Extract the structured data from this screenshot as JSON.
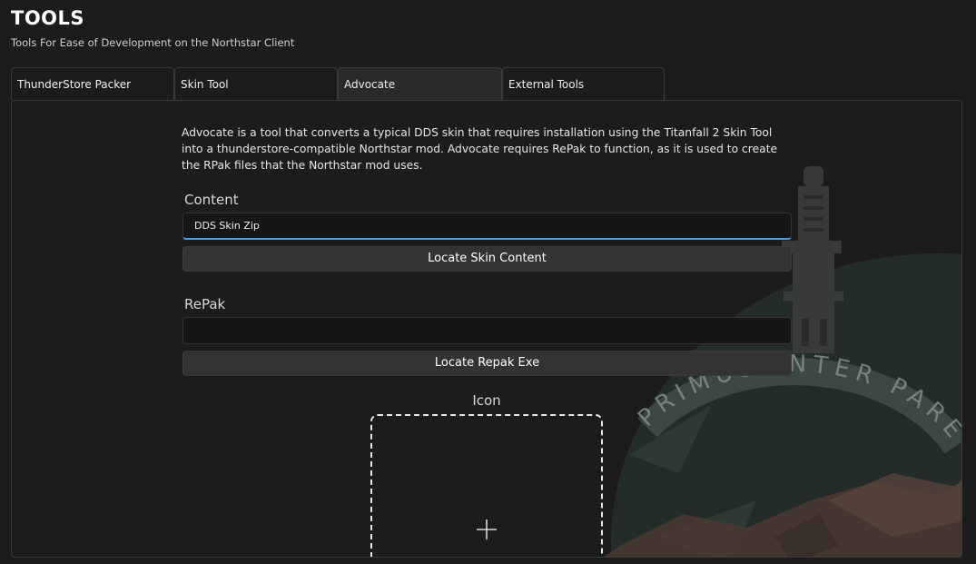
{
  "header": {
    "title": "TOOLS",
    "subtitle": "Tools For Ease of Development on the Northstar Client"
  },
  "tabs": [
    {
      "label": "ThunderStore Packer",
      "active": false
    },
    {
      "label": "Skin Tool",
      "active": false
    },
    {
      "label": "Advocate",
      "active": true
    },
    {
      "label": "External Tools",
      "active": false
    }
  ],
  "advocate": {
    "description": "Advocate is a tool that converts a typical DDS skin that requires installation using the Titanfall 2 Skin Tool into a thunderstore-compatible Northstar mod. Advocate requires RePak to function, as it is used to create the RPak files that the Northstar mod uses.",
    "content": {
      "label": "Content",
      "value": "",
      "placeholder": "DDS Skin Zip",
      "button_label": "Locate Skin Content"
    },
    "repak": {
      "label": "RePak",
      "value": "",
      "placeholder": "",
      "button_label": "Locate Repak Exe"
    },
    "icon": {
      "label": "Icon",
      "add_icon": "plus-icon"
    }
  },
  "background": {
    "emblem_text": "PRIMUS INTER PARES"
  },
  "colors": {
    "background": "#1c1c1c",
    "input_focus_accent": "#4a9de0",
    "button": "#333333",
    "emblem_green": "#2c3a34",
    "emblem_brown": "#4a3a31"
  }
}
